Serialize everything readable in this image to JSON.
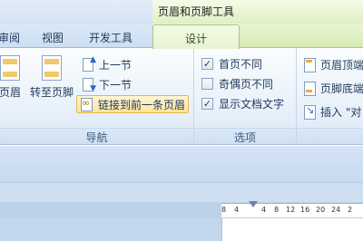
{
  "context_tab_group": {
    "title": "页眉和页脚工具"
  },
  "tabs": [
    {
      "label": "审阅"
    },
    {
      "label": "视图"
    },
    {
      "label": "开发工具"
    },
    {
      "label": "设计"
    }
  ],
  "ribbon": {
    "partial_button_label": "页眉",
    "goto_footer_label": "转至页脚",
    "navigation": {
      "previous_label": "上一节",
      "next_label": "下一节",
      "link_previous_label": "链接到前一条页眉",
      "caption": "导航"
    },
    "options": {
      "items": [
        {
          "label": "首页不同",
          "checked": true
        },
        {
          "label": "奇偶页不同",
          "checked": false
        },
        {
          "label": "显示文档文字",
          "checked": true
        }
      ],
      "caption": "选项"
    },
    "position": {
      "header_from_top_label": "页眉顶端",
      "footer_from_bottom_label": "页脚底端",
      "insert_label": "插入 \"对"
    }
  },
  "ruler": {
    "ticks": [
      "8",
      "4",
      "",
      "4",
      "8",
      "12",
      "16",
      "20",
      "24",
      "2"
    ]
  },
  "colors": {
    "context_tab": "#dff0c0",
    "ribbon_bg": "#e9f1fa",
    "highlight": "#ffe39a"
  }
}
